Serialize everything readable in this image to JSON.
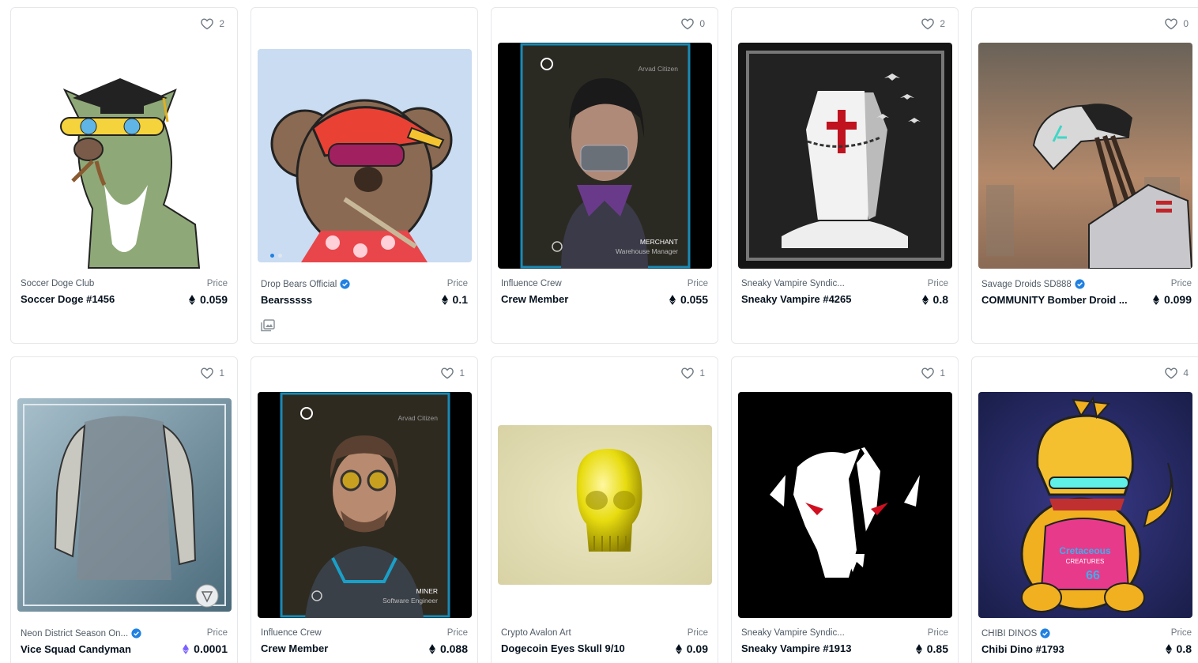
{
  "cards": [
    {
      "favorites": "2",
      "collection": "Soccer Doge Club",
      "verified": false,
      "name": "Soccer Doge #1456",
      "price_label": "Price",
      "price": "0.059",
      "currency": "eth"
    },
    {
      "favorites": "",
      "collection": "Drop Bears Official",
      "verified": true,
      "name": "Bearsssss",
      "price_label": "Price",
      "price": "0.1",
      "currency": "eth"
    },
    {
      "favorites": "0",
      "collection": "Influence Crew",
      "verified": false,
      "name": "Crew Member",
      "price_label": "Price",
      "price": "0.055",
      "currency": "eth",
      "card_header": "Arvad Citizen",
      "card_role": "MERCHANT",
      "card_title": "Warehouse Manager"
    },
    {
      "favorites": "2",
      "collection": "Sneaky Vampire Syndic...",
      "verified": false,
      "name": "Sneaky Vampire #4265",
      "price_label": "Price",
      "price": "0.8",
      "currency": "eth"
    },
    {
      "favorites": "0",
      "collection": "Savage Droids SD888",
      "verified": true,
      "name": "COMMUNITY Bomber Droid ...",
      "price_label": "Price",
      "price": "0.099",
      "currency": "eth"
    },
    {
      "favorites": "1",
      "collection": "Neon District Season On...",
      "verified": true,
      "name": "Vice Squad Candyman",
      "price_label": "Price",
      "price": "0.0001",
      "currency": "weth"
    },
    {
      "favorites": "1",
      "collection": "Influence Crew",
      "verified": false,
      "name": "Crew Member",
      "price_label": "Price",
      "price": "0.088",
      "currency": "eth",
      "card_header": "Arvad Citizen",
      "card_role": "MINER",
      "card_title": "Software Engineer"
    },
    {
      "favorites": "1",
      "collection": "Crypto Avalon Art",
      "verified": false,
      "name": "Dogecoin Eyes Skull 9/10",
      "price_label": "Price",
      "price": "0.09",
      "currency": "eth"
    },
    {
      "favorites": "1",
      "collection": "Sneaky Vampire Syndic...",
      "verified": false,
      "name": "Sneaky Vampire #1913",
      "price_label": "Price",
      "price": "0.85",
      "currency": "eth"
    },
    {
      "favorites": "4",
      "collection": "CHIBI DINOS",
      "verified": true,
      "name": "Chibi Dino #1793",
      "price_label": "Price",
      "price": "0.8",
      "currency": "eth",
      "art_text": "Cretaceous",
      "art_text2": "CREATURES",
      "art_number": "66"
    }
  ],
  "colors": {
    "verified": "#2081e2",
    "eth": "#04111d",
    "weth": "#7b61ff",
    "border": "#e5e8eb"
  }
}
